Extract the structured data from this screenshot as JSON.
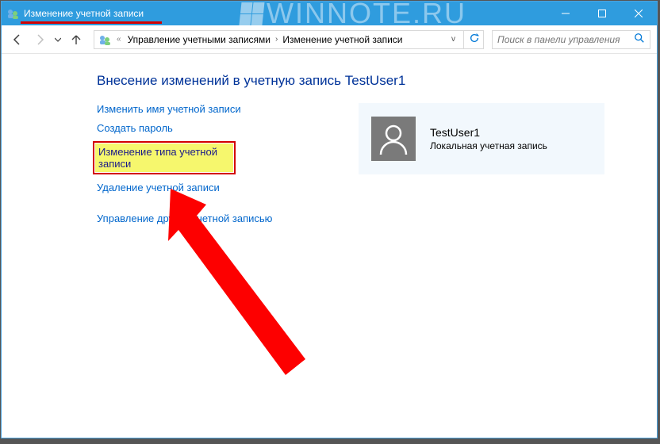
{
  "window": {
    "title": "Изменение учетной записи"
  },
  "watermark": "WINNOTE.RU",
  "breadcrumb": {
    "prefix": "«",
    "level1": "Управление учетными записями",
    "level2": "Изменение учетной записи"
  },
  "search": {
    "placeholder": "Поиск в панели управления"
  },
  "page": {
    "title": "Внесение изменений в учетную запись TestUser1"
  },
  "links": {
    "rename": "Изменить имя учетной записи",
    "create_password": "Создать пароль",
    "change_type": "Изменение типа учетной записи",
    "delete": "Удаление учетной записи",
    "manage_other": "Управление другой учетной записью"
  },
  "user": {
    "name": "TestUser1",
    "type": "Локальная учетная запись"
  }
}
